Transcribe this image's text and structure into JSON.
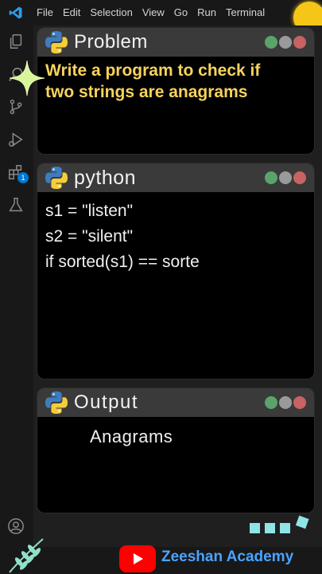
{
  "menu": [
    "File",
    "Edit",
    "Selection",
    "View",
    "Go",
    "Run",
    "Terminal"
  ],
  "activity_badge": "1",
  "panels": {
    "problem": {
      "title": "Problem",
      "text_line1": "Write a program to check if",
      "text_line2": "two strings are anagrams"
    },
    "code": {
      "title": "python",
      "lines": [
        "s1 = \"listen\"",
        "s2 = \"silent\"",
        "if sorted(s1) == sorte"
      ]
    },
    "output": {
      "title": "Output",
      "text": "Anagrams"
    }
  },
  "brand": {
    "name": "Zeeshan Academy"
  },
  "colors": {
    "dot_green": "#5aa46b",
    "dot_grey": "#9a9a9a",
    "dot_red": "#c96262",
    "highlight_text": "#f7d35c",
    "brand_blue": "#4aa3ff",
    "sun": "#f5c518"
  }
}
